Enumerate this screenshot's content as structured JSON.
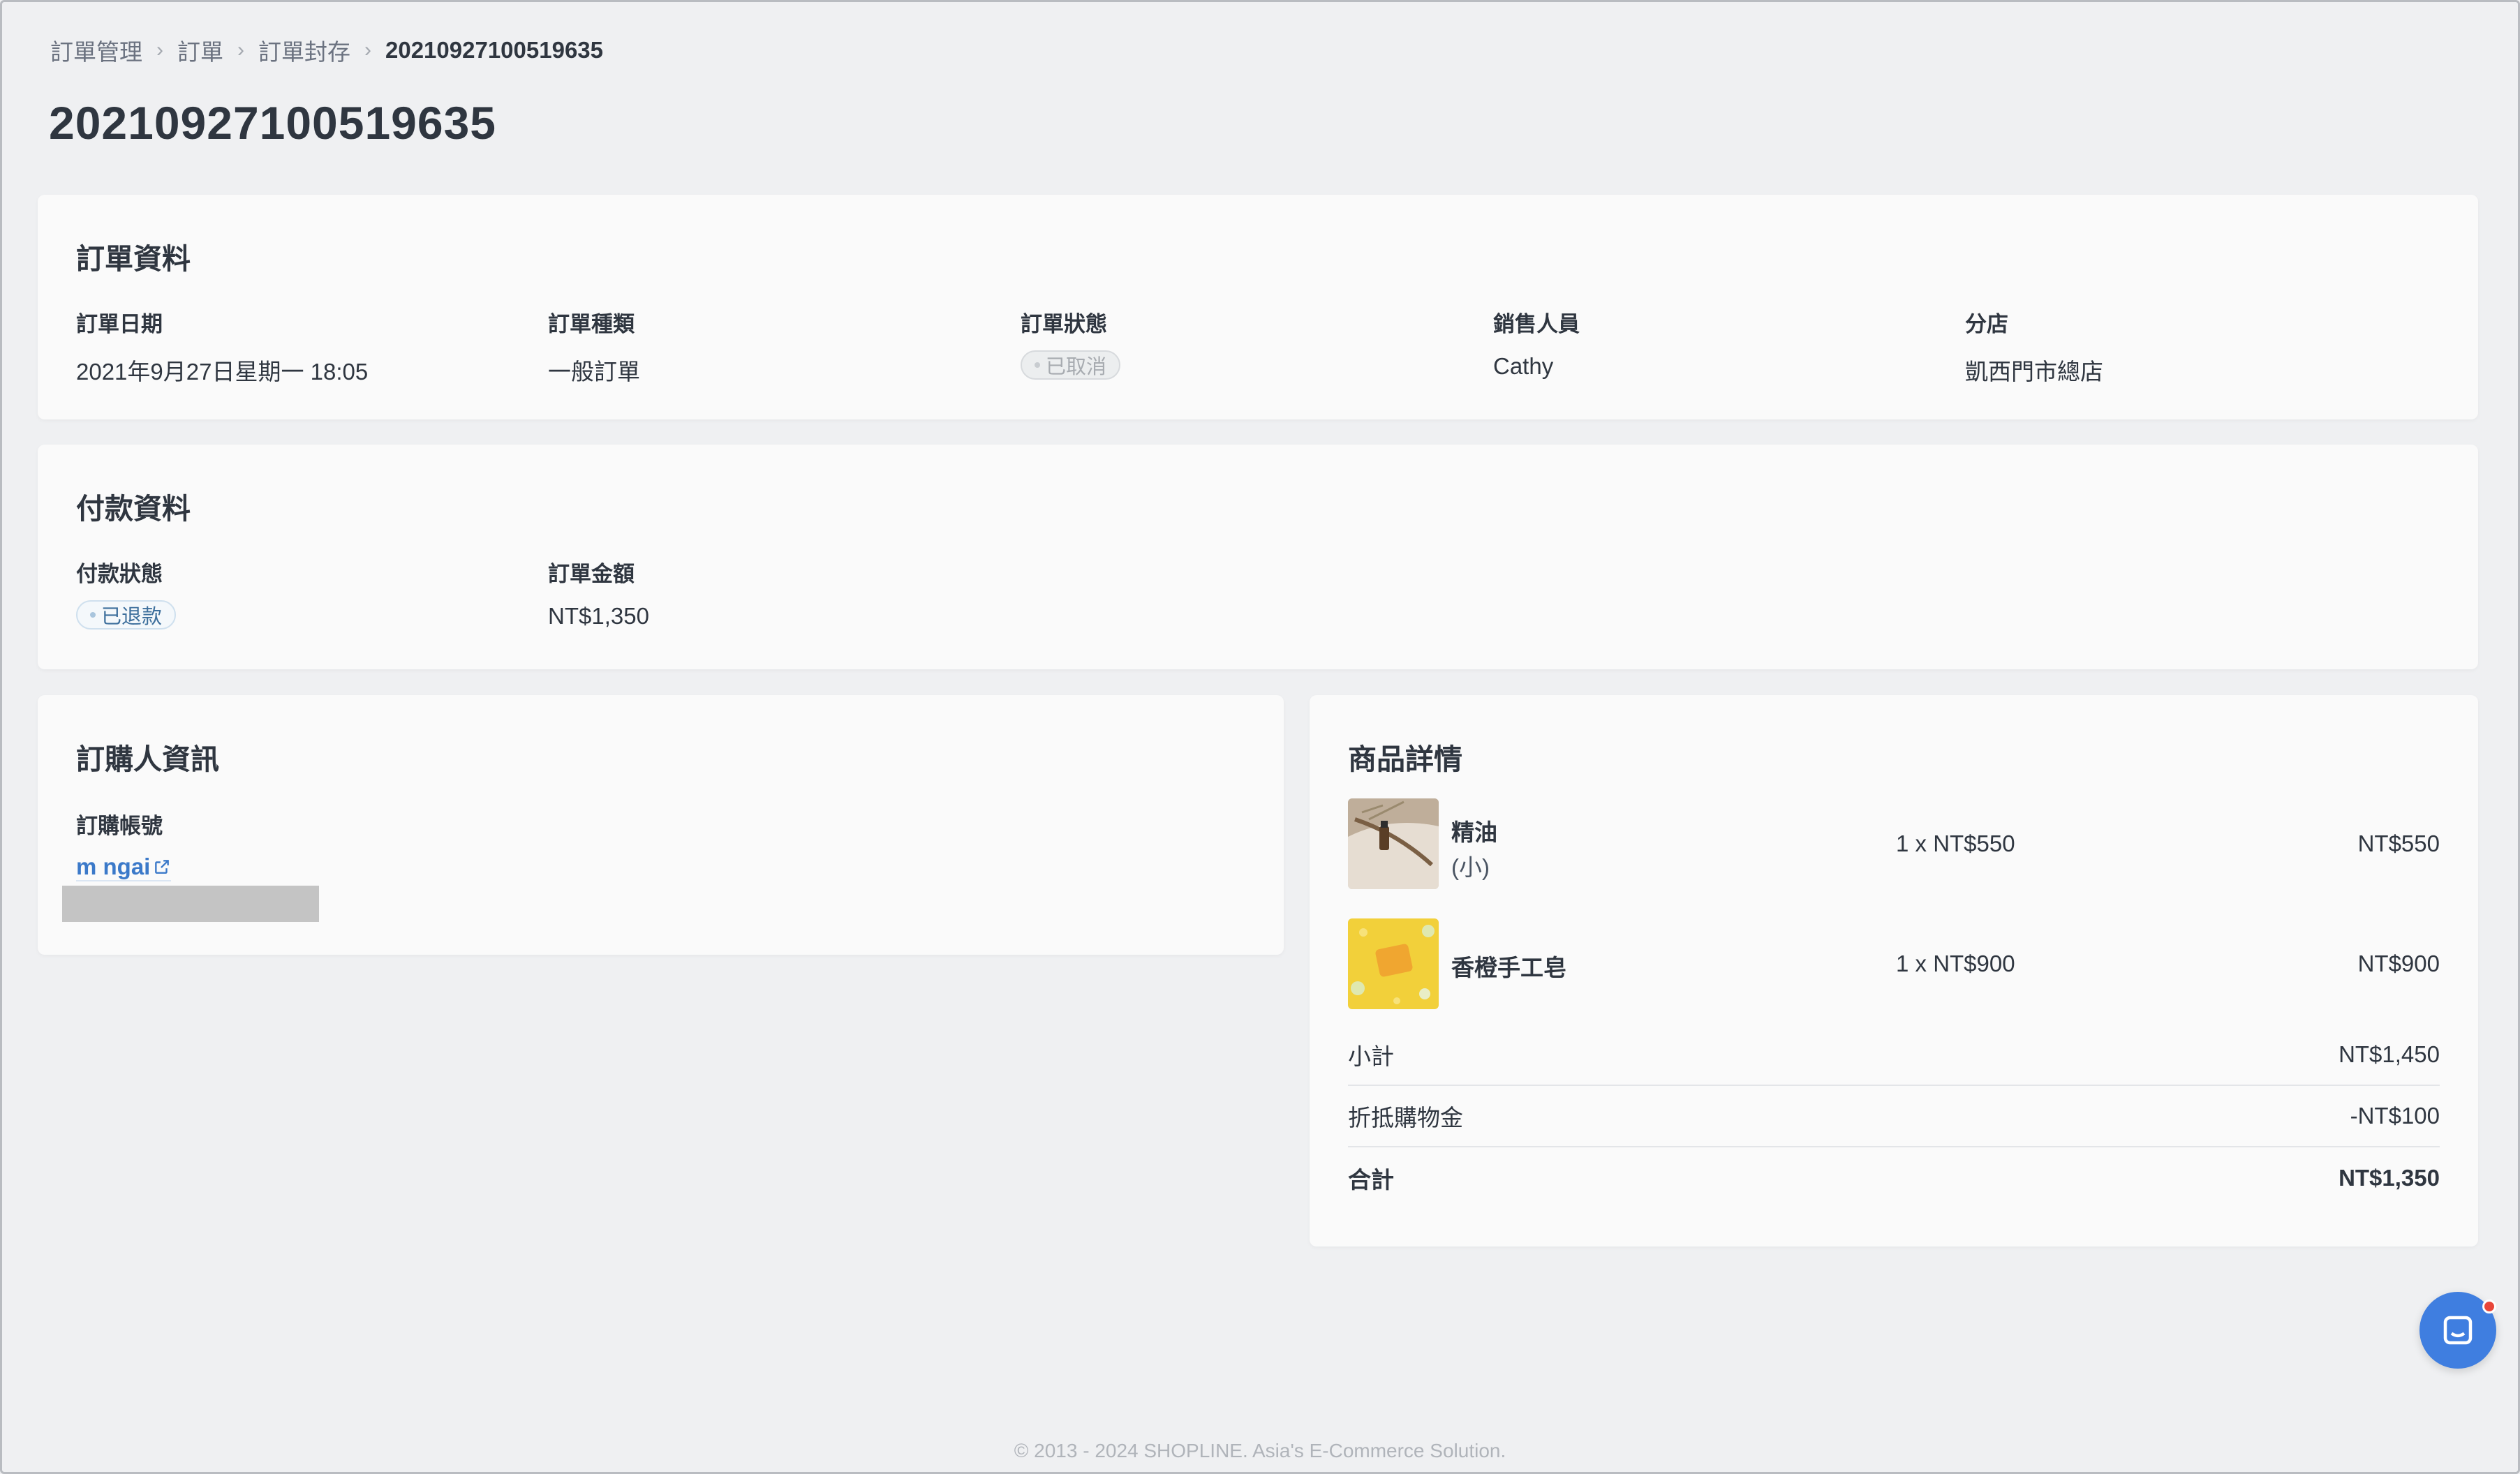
{
  "breadcrumb": {
    "items": [
      "訂單管理",
      "訂單",
      "訂單封存"
    ],
    "current": "20210927100519635"
  },
  "page_title": "20210927100519635",
  "order_info": {
    "title": "訂單資料",
    "fields": [
      {
        "label": "訂單日期",
        "value": "2021年9月27日星期一 18:05"
      },
      {
        "label": "訂單種類",
        "value": "一般訂單"
      },
      {
        "label": "訂單狀態",
        "value": "已取消"
      },
      {
        "label": "銷售人員",
        "value": "Cathy"
      },
      {
        "label": "分店",
        "value": "凱西門市總店"
      }
    ]
  },
  "payment_info": {
    "title": "付款資料",
    "status_label": "付款狀態",
    "status_value": "已退款",
    "amount_label": "訂單金額",
    "amount_value": "NT$1,350"
  },
  "buyer_info": {
    "title": "訂購人資訊",
    "account_label": "訂購帳號",
    "account_name": "m ngai"
  },
  "product_details": {
    "title": "商品詳情",
    "items": [
      {
        "name": "精油",
        "variant": "(小)",
        "qty_price": "1 x NT$550",
        "total": "NT$550",
        "thumb_icon": "essential-oil-image"
      },
      {
        "name": "香橙手工皂",
        "variant": "",
        "qty_price": "1 x NT$900",
        "total": "NT$900",
        "thumb_icon": "orange-soap-image"
      }
    ],
    "summary": [
      {
        "label": "小計",
        "value": "NT$1,450"
      },
      {
        "label": "折抵購物金",
        "value": "-NT$100"
      },
      {
        "label": "合計",
        "value": "NT$1,350"
      }
    ]
  },
  "footer": "© 2013 - 2024 SHOPLINE. Asia's E-Commerce Solution.",
  "colors": {
    "background": "#eff0f2",
    "card": "#fafafa",
    "link": "#3b79c9",
    "chat_button": "#3f7ee0",
    "notification_dot": "#e8463a"
  }
}
